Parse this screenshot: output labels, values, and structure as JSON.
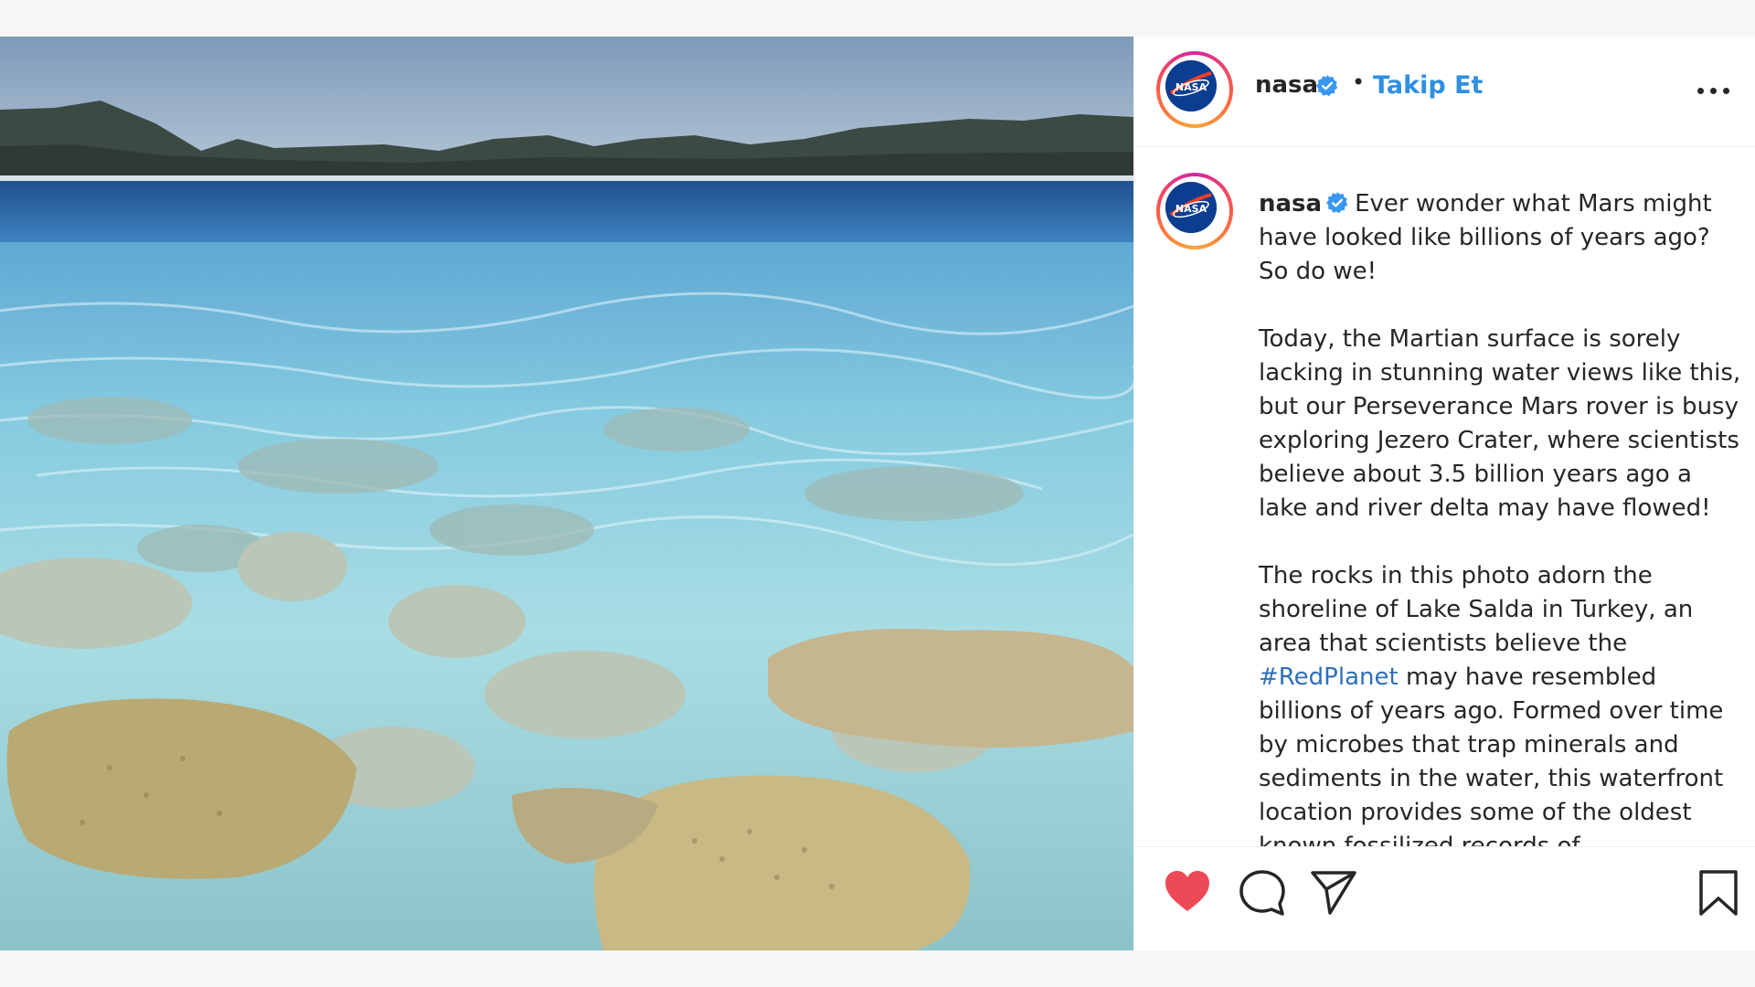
{
  "post": {
    "username": "nasa",
    "follow_label": "Takip Et",
    "separator": "•"
  },
  "caption": {
    "username": "nasa",
    "paragraphs": [
      "Ever wonder what Mars might have looked like billions of years ago? So do we!",
      "Today, the Martian surface is sorely lacking in stunning water views like this, but our Perseverance Mars rover is busy exploring Jezero Crater, where scientists believe about 3.5 billion years ago a lake and river delta may have flowed!"
    ],
    "p3_before": "The rocks in this photo adorn the shoreline of Lake Salda in Turkey, an area that scientists believe the ",
    "p3_hashtag": "#RedPlanet",
    "p3_after": " may have resembled billions of years ago. Formed over time by microbes that trap minerals and sediments in the water, this waterfront location provides some of the oldest known fossilized records of"
  },
  "icons": {
    "verified": "verified-badge-icon",
    "like": "heart-filled-icon",
    "comment": "comment-bubble-icon",
    "share": "paper-plane-icon",
    "save": "bookmark-icon",
    "more": "more-horizontal-icon",
    "avatar": "nasa-logo"
  },
  "colors": {
    "link_blue": "#2f8fe0",
    "hashtag_blue": "#2f6fb8",
    "like_red": "#ed4956",
    "verified_blue": "#3897f0",
    "nasa_blue": "#0b3d91"
  }
}
